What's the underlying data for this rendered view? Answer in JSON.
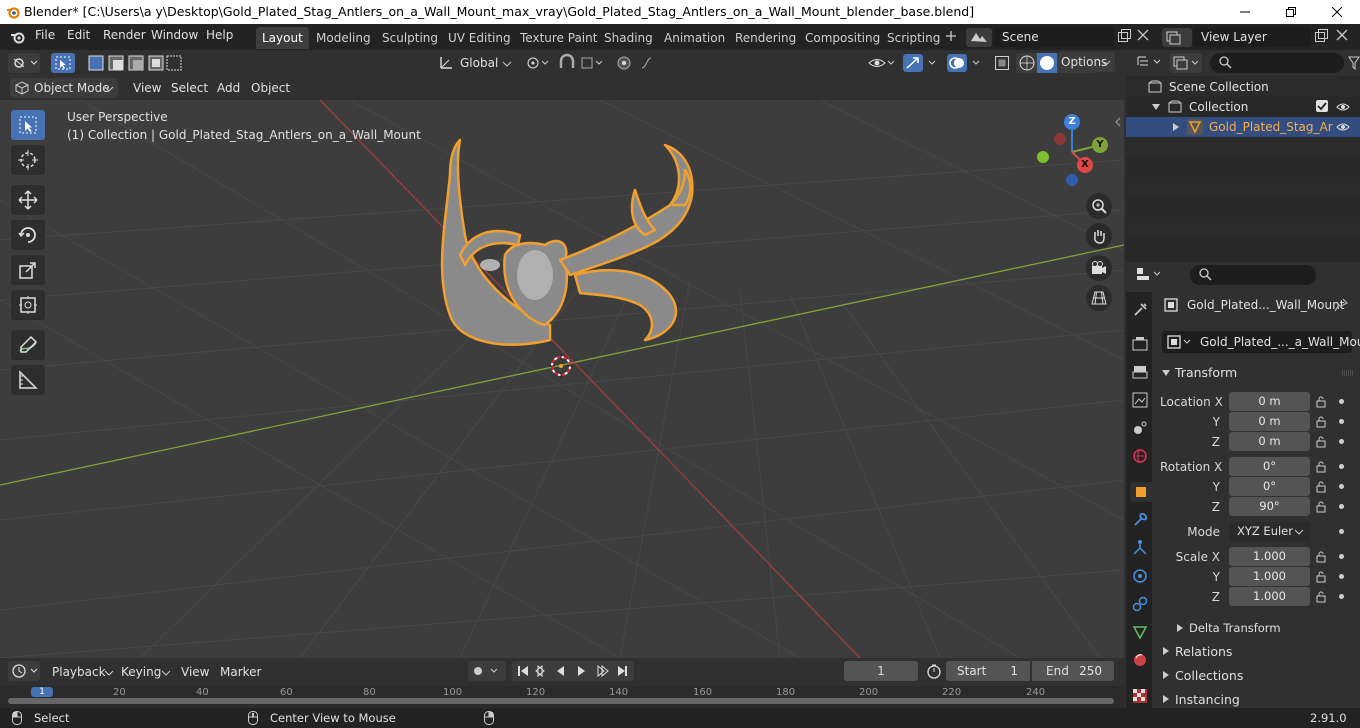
{
  "window": {
    "title": "Blender* [C:\\Users\\a y\\Desktop\\Gold_Plated_Stag_Antlers_on_a_Wall_Mount_max_vray\\Gold_Plated_Stag_Antlers_on_a_Wall_Mount_blender_base.blend]"
  },
  "menu": {
    "file": "File",
    "edit": "Edit",
    "render": "Render",
    "window": "Window",
    "help": "Help"
  },
  "workspaces": [
    "Layout",
    "Modeling",
    "Sculpting",
    "UV Editing",
    "Texture Paint",
    "Shading",
    "Animation",
    "Rendering",
    "Compositing",
    "Scripting"
  ],
  "scene": {
    "name": "Scene",
    "view_layer": "View Layer"
  },
  "viewport_header": {
    "mode": "Object Mode",
    "view": "View",
    "select": "Select",
    "add": "Add",
    "object": "Object",
    "orientation": "Global",
    "options": "Options"
  },
  "viewport": {
    "perspective": "User Perspective",
    "collection_info": "(1) Collection | Gold_Plated_Stag_Antlers_on_a_Wall_Mount",
    "gizmo_x": "X",
    "gizmo_y": "Y",
    "gizmo_z": "Z"
  },
  "outliner": {
    "scene_collection": "Scene Collection",
    "collection": "Collection",
    "object": "Gold_Plated_Stag_Ar"
  },
  "properties": {
    "object_name": "Gold_Plated..._Wall_Mount",
    "data_name": "Gold_Plated_..._a_Wall_Mount",
    "transform": "Transform",
    "location_x_label": "Location X",
    "y_label": "Y",
    "z_label": "Z",
    "rotation_x_label": "Rotation X",
    "scale_x_label": "Scale X",
    "mode_label": "Mode",
    "location": [
      "0 m",
      "0 m",
      "0 m"
    ],
    "rotation": [
      "0°",
      "0°",
      "90°"
    ],
    "rotation_mode": "XYZ Euler",
    "scale": [
      "1.000",
      "1.000",
      "1.000"
    ],
    "delta_transform": "Delta Transform",
    "relations": "Relations",
    "collections": "Collections",
    "instancing": "Instancing"
  },
  "timeline": {
    "playback": "Playback",
    "keying": "Keying",
    "view": "View",
    "marker": "Marker",
    "current_frame": "1",
    "start_label": "Start",
    "start": "1",
    "end_label": "End",
    "end": "250",
    "ticks": [
      "1",
      "20",
      "40",
      "60",
      "80",
      "100",
      "120",
      "140",
      "160",
      "180",
      "200",
      "220",
      "240"
    ]
  },
  "statusbar": {
    "select": "Select",
    "center_view": "Center View to Mouse",
    "version": "2.91.0"
  },
  "colors": {
    "accent": "#4772b3",
    "selection_outline": "#f0a030",
    "x_axis": "#d04a4a",
    "y_axis": "#7fa33a",
    "z_axis": "#3e7fde"
  }
}
